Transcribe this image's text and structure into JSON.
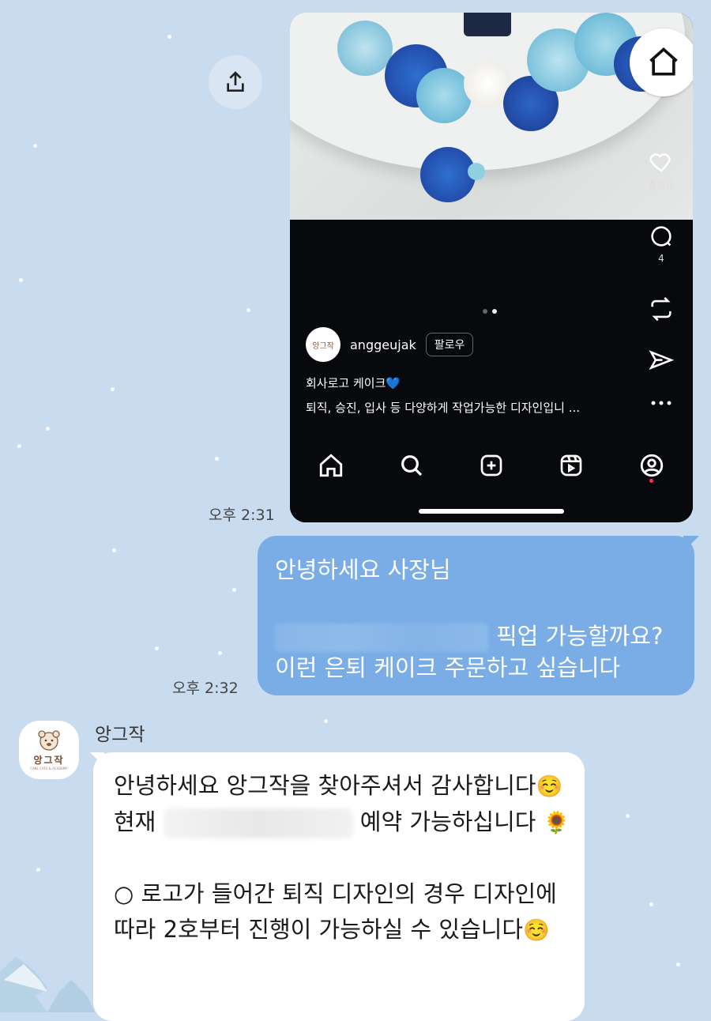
{
  "share": {
    "icon": "share-icon"
  },
  "post": {
    "username": "anggeujak",
    "follow_label": "팔로우",
    "avatar_text": "앙그작",
    "caption_line1": "회사로고 케이크💙",
    "caption_line2": "퇴직, 승진, 입사 등 다양하게 작업가능한 디자인입니 ...",
    "like_label": "좋아요",
    "comment_count": "4",
    "carousel": {
      "current": 2,
      "total": 2
    }
  },
  "messages": {
    "out": {
      "time": "오후 2:31",
      "line1": "안녕하세요 사장님",
      "line2": "픽업 가능할까요?",
      "line3": "이런 은퇴 케이크 주문하고 싶습니다",
      "time2": "오후 2:32"
    },
    "in": {
      "sender": "앙그작",
      "avatar_text": "앙그작",
      "avatar_sub": "CAKE CAFE & ACADEMY",
      "text_a": "안녕하세요 앙그작을 찾아주셔서 감사합니다",
      "emoji1": "☺️",
      "text_b": " 현재 ",
      "text_c": " 예약 가능하십니다 ",
      "emoji2": "🌻",
      "text_d": "○ 로고가 들어간 퇴직 디자인의 경우 디자인에 따라 2호부터 진행이 가능하실 수 있습니다",
      "emoji3": "☺️"
    }
  },
  "colors": {
    "background": "#c9dbee",
    "outgoing_bubble": "#7aade6",
    "incoming_bubble": "#ffffff"
  }
}
